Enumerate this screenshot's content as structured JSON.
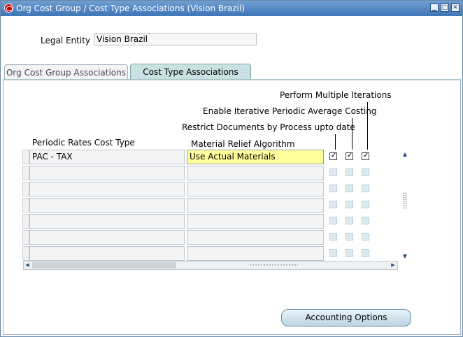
{
  "window": {
    "title": "Org Cost Group / Cost Type Associations (Vision Brazil)",
    "controls": {
      "minimize": "▁",
      "maximize": "□",
      "close": "✕"
    }
  },
  "legal_entity": {
    "label": "Legal Entity",
    "value": "Vision Brazil"
  },
  "tabs": [
    {
      "label": "Org Cost Group Associations",
      "active": false
    },
    {
      "label": "Cost Type Associations",
      "active": true
    }
  ],
  "table": {
    "headers": {
      "perform_multiple_iterations": "Perform Multiple Iterations",
      "enable_iterative": "Enable Iterative Periodic Average Costing",
      "restrict_documents": "Restrict Documents by Process upto date",
      "cost_type": "Periodic Rates Cost Type",
      "material_relief": "Material Relief Algorithm"
    },
    "rows": [
      {
        "cost_type": "PAC - TAX",
        "algorithm": "Use Actual Materials",
        "restrict": true,
        "enable": true,
        "perform": true
      },
      {
        "cost_type": "",
        "algorithm": "",
        "restrict": false,
        "enable": false,
        "perform": false
      },
      {
        "cost_type": "",
        "algorithm": "",
        "restrict": false,
        "enable": false,
        "perform": false
      },
      {
        "cost_type": "",
        "algorithm": "",
        "restrict": false,
        "enable": false,
        "perform": false
      },
      {
        "cost_type": "",
        "algorithm": "",
        "restrict": false,
        "enable": false,
        "perform": false
      },
      {
        "cost_type": "",
        "algorithm": "",
        "restrict": false,
        "enable": false,
        "perform": false
      },
      {
        "cost_type": "",
        "algorithm": "",
        "restrict": false,
        "enable": false,
        "perform": false
      }
    ]
  },
  "buttons": {
    "accounting_options": "Accounting Options"
  },
  "colors": {
    "titlebar": "#4a80bf",
    "active_tab": "#c9e1e3",
    "current_field": "#ffff9c"
  }
}
